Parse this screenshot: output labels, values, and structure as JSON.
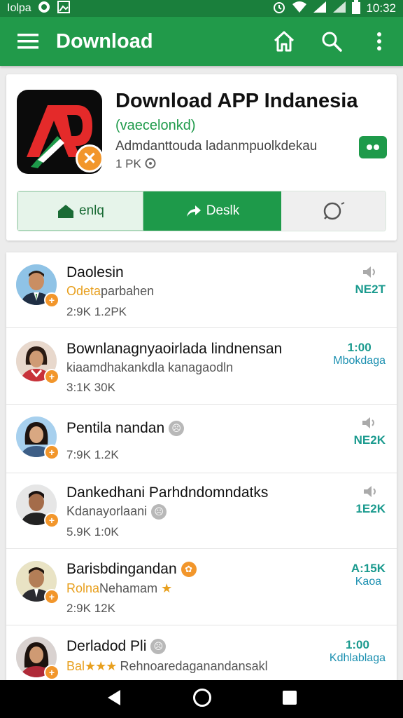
{
  "status_bar": {
    "left_text": "Iolpa",
    "time": "10:32"
  },
  "app_bar": {
    "title": "Download",
    "icons": [
      "menu-icon",
      "home-icon",
      "search-icon",
      "more-vert-icon"
    ]
  },
  "app_card": {
    "title": "Download APP Indanesia",
    "subtitle": "(vaecelonkd)",
    "description": "Admdanttouda ladanmpuolkdekau",
    "size": "1 PK",
    "segments": [
      {
        "label": "enlq",
        "icon": "home-icon"
      },
      {
        "label": "Deslk",
        "icon": "share-icon"
      },
      {
        "label": "",
        "icon": "chat-icon"
      }
    ]
  },
  "list": [
    {
      "name": "Daolesin",
      "sub_highlight": "Odeta",
      "sub": "parbahen",
      "stats": "2:9K   1.2PK",
      "right_num": "NE2T",
      "right_sub": "",
      "right_icon": "speaker-icon"
    },
    {
      "name": "Bownlanagnyaoirlada lindnensan",
      "sub_highlight": "",
      "sub": "kiaamdhakankdla kanagaodln",
      "stats": "3:1K   30K",
      "right_num": "1:00",
      "right_sub": "Mbokdaga",
      "right_icon": ""
    },
    {
      "name": "Pentila nandan",
      "sub_highlight": "",
      "sub": "",
      "stats": "7:9K   1.2K",
      "right_num": "NE2K",
      "right_sub": "",
      "right_icon": "speaker-icon"
    },
    {
      "name": "Dankedhani Parhdndomndatks",
      "sub_highlight": "",
      "sub": "Kdanayorlaani",
      "stats": "5.9K   1:0K",
      "right_num": "1E2K",
      "right_sub": "",
      "right_icon": "speaker-icon"
    },
    {
      "name": "Barisbdingandan",
      "sub_highlight": "Rolna",
      "sub": "Nehamam",
      "stats": "2:9K   12K",
      "right_num": "A:15K",
      "right_sub": "Kaoa",
      "right_icon": ""
    },
    {
      "name": "Derladod Pli",
      "sub_highlight": "Bal",
      "sub": "Rehnoaredaganandansakl",
      "stats": "",
      "right_num": "1:00",
      "right_sub": "Kdhlablaga",
      "right_icon": ""
    }
  ],
  "nav_bar": {
    "icons": [
      "back-icon",
      "home-circle-icon",
      "recents-icon"
    ]
  }
}
